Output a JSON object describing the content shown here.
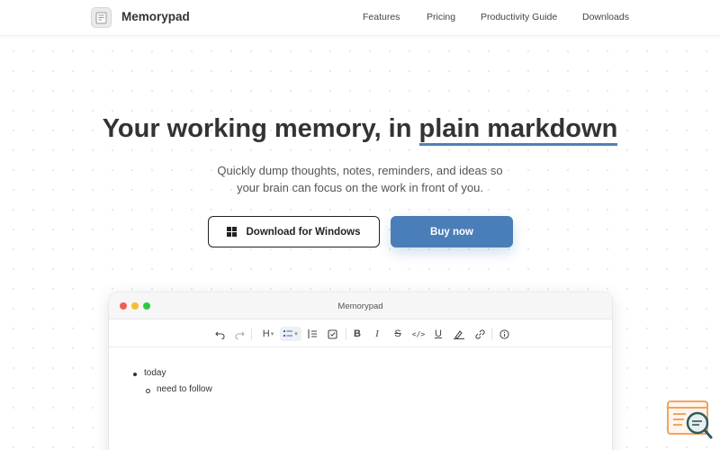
{
  "brand": {
    "name": "Memorypad",
    "logo_icon": "notepad-icon"
  },
  "nav": {
    "links": [
      "Features",
      "Pricing",
      "Productivity Guide",
      "Downloads"
    ]
  },
  "hero": {
    "title_prefix": "Your working memory, in",
    "title_highlight": "plain markdown",
    "subtitle_line1": "Quickly dump thoughts, notes, reminders, and ideas so",
    "subtitle_line2": "your brain can focus on the work in front of you.",
    "download_button": "Download for Windows",
    "download_icon": "windows-icon",
    "buy_button": "Buy now"
  },
  "colors": {
    "accent": "#4a7eb8",
    "underline": "#4f7fb8",
    "traffic_red": "#ee5e56",
    "traffic_yellow": "#f5be2f",
    "traffic_green": "#2ec840"
  },
  "app_window": {
    "title": "Memorypad",
    "toolbar": [
      "undo-icon",
      "redo-icon",
      "heading-icon",
      "list-style-icon",
      "ordered-list-icon",
      "checkbox-icon",
      "bold-icon",
      "italic-icon",
      "strikethrough-icon",
      "code-icon",
      "underline-icon",
      "highlight-icon",
      "link-icon",
      "info-icon"
    ],
    "toolbar_glyphs": {
      "heading": "H",
      "bold": "B",
      "italic": "I",
      "strike": "S",
      "code": "</>",
      "underline": "U"
    },
    "editor": {
      "item1": "today",
      "item1_child": "need to follow"
    }
  },
  "widget": {
    "icon": "search-window-icon"
  }
}
